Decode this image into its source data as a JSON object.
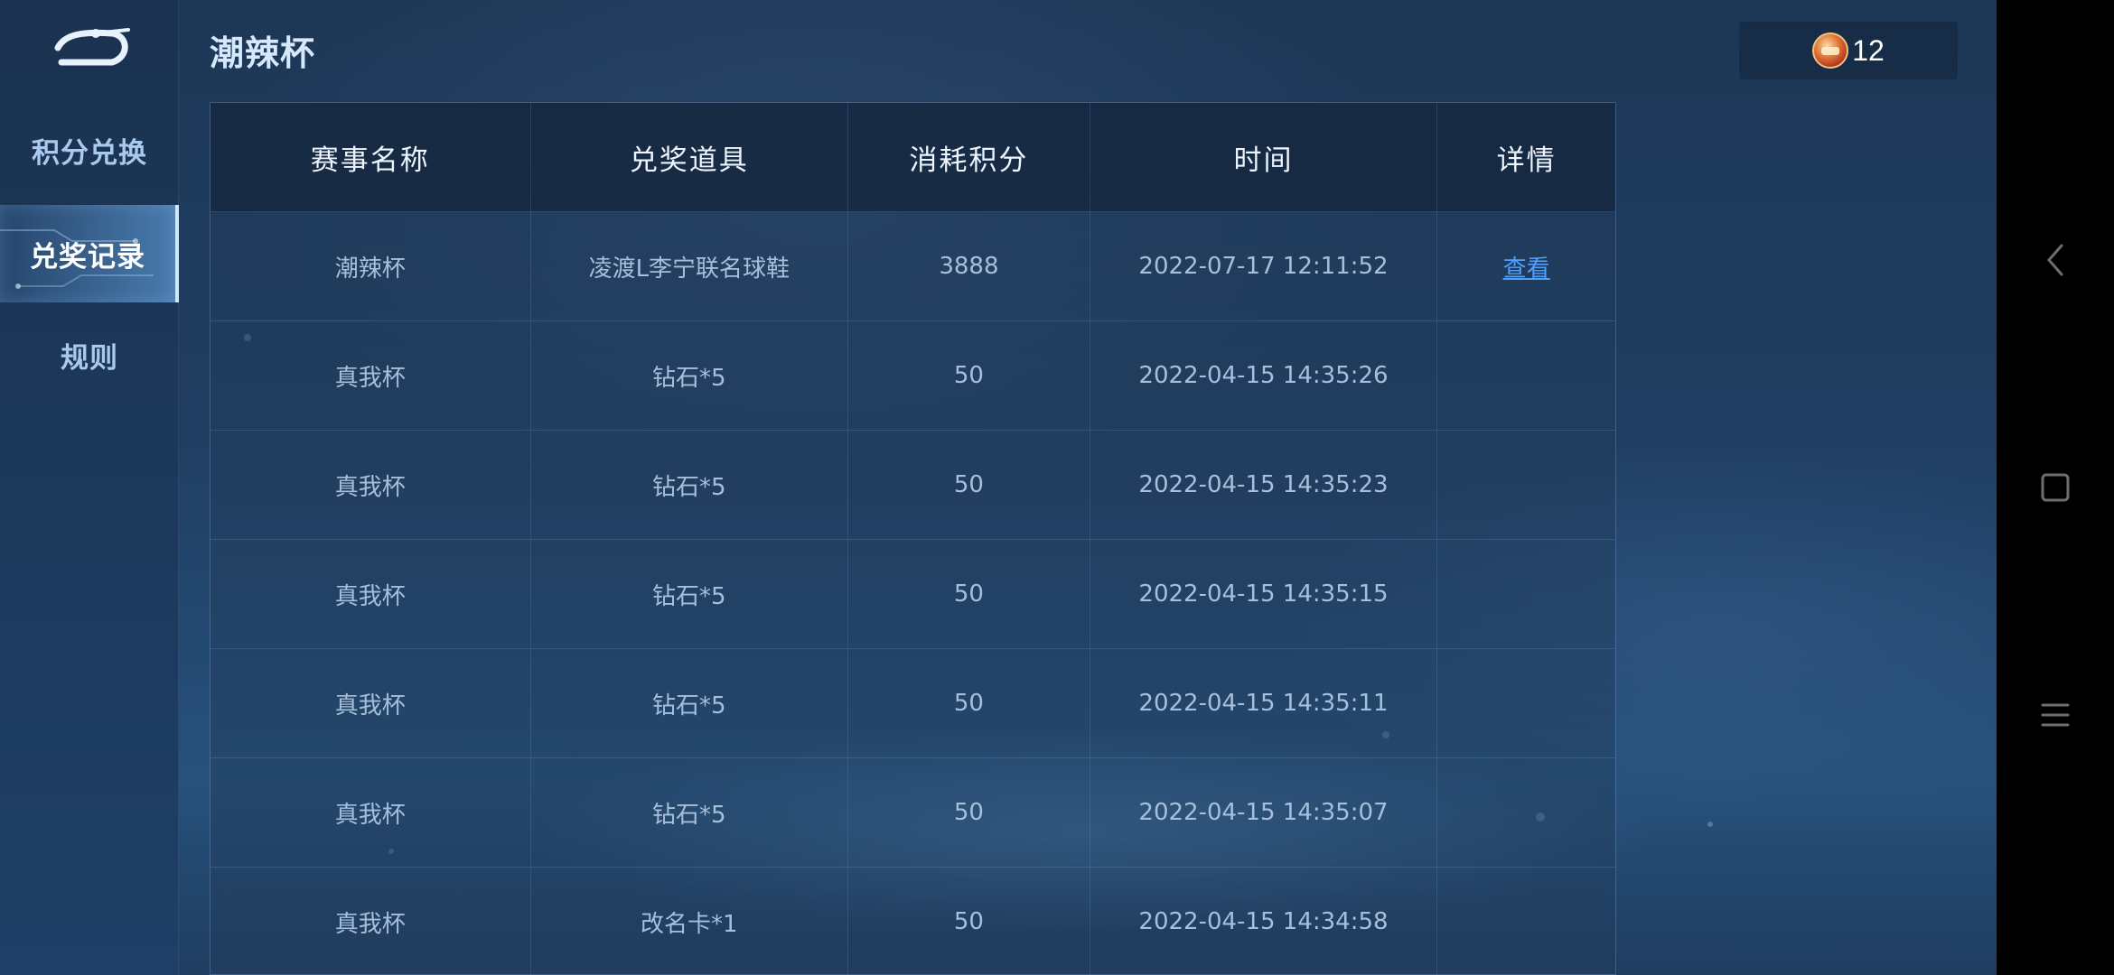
{
  "sidebar": {
    "items": [
      {
        "label": "积分兑换",
        "active": false
      },
      {
        "label": "兑奖记录",
        "active": true
      },
      {
        "label": "规则",
        "active": false
      }
    ]
  },
  "header": {
    "title": "潮辣杯",
    "coin_count": "12"
  },
  "table": {
    "columns": [
      "赛事名称",
      "兑奖道具",
      "消耗积分",
      "时间",
      "详情"
    ],
    "rows": [
      {
        "event": "潮辣杯",
        "item": "凌渡L李宁联名球鞋",
        "points": "3888",
        "time": "2022-07-17 12:11:52",
        "detail": "查看"
      },
      {
        "event": "真我杯",
        "item": "钻石*5",
        "points": "50",
        "time": "2022-04-15 14:35:26",
        "detail": ""
      },
      {
        "event": "真我杯",
        "item": "钻石*5",
        "points": "50",
        "time": "2022-04-15 14:35:23",
        "detail": ""
      },
      {
        "event": "真我杯",
        "item": "钻石*5",
        "points": "50",
        "time": "2022-04-15 14:35:15",
        "detail": ""
      },
      {
        "event": "真我杯",
        "item": "钻石*5",
        "points": "50",
        "time": "2022-04-15 14:35:11",
        "detail": ""
      },
      {
        "event": "真我杯",
        "item": "钻石*5",
        "points": "50",
        "time": "2022-04-15 14:35:07",
        "detail": ""
      },
      {
        "event": "真我杯",
        "item": "改名卡*1",
        "points": "50",
        "time": "2022-04-15 14:34:58",
        "detail": ""
      }
    ]
  },
  "icons": {
    "back": "back-arrow-icon",
    "coin": "coin-icon",
    "sys_back": "chevron-left-icon",
    "sys_home": "square-icon",
    "sys_menu": "menu-lines-icon"
  }
}
